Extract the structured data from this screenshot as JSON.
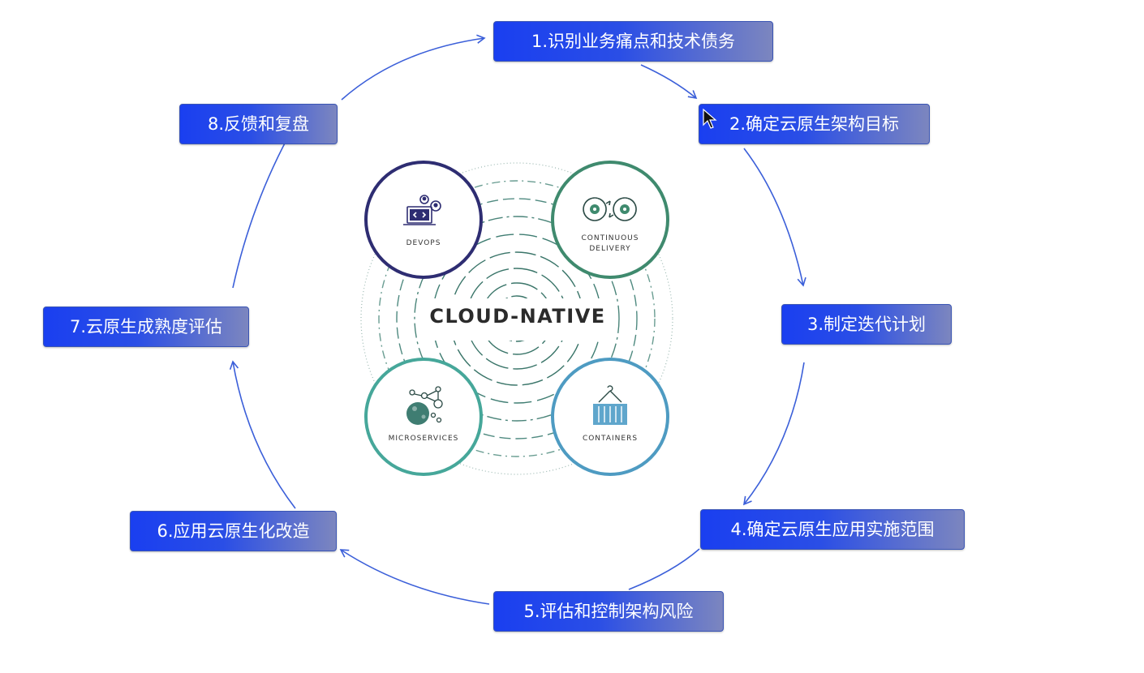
{
  "center": {
    "title": "CLOUD-NATIVE"
  },
  "pillars": [
    {
      "label": "DEVOPS",
      "color": "#2e2d72",
      "icon": "laptop-code-users-icon"
    },
    {
      "label_line1": "CONTINUOUS",
      "label_line2": "DELIVERY",
      "color": "#3f8a6e",
      "icon": "gear-cycle-icon"
    },
    {
      "label": "MICROSERVICES",
      "color": "#46a79a",
      "icon": "molecule-icon"
    },
    {
      "label": "CONTAINERS",
      "color": "#4e9bc2",
      "icon": "shipping-container-icon"
    }
  ],
  "steps": [
    {
      "label": "1.识别业务痛点和技术债务"
    },
    {
      "label": "2.确定云原生架构目标"
    },
    {
      "label": "3.制定迭代计划"
    },
    {
      "label": "4.确定云原生应用实施范围"
    },
    {
      "label": "5.评估和控制架构风险"
    },
    {
      "label": "6.应用云原生化改造"
    },
    {
      "label": "7.云原生成熟度评估"
    },
    {
      "label": "8.反馈和复盘"
    }
  ],
  "colors": {
    "step_fill_start": "#1a3ff0",
    "step_fill_end": "#7c86bf",
    "arrow": "#3b5fd9"
  },
  "cursor": {
    "icon": "mouse-pointer-icon"
  }
}
